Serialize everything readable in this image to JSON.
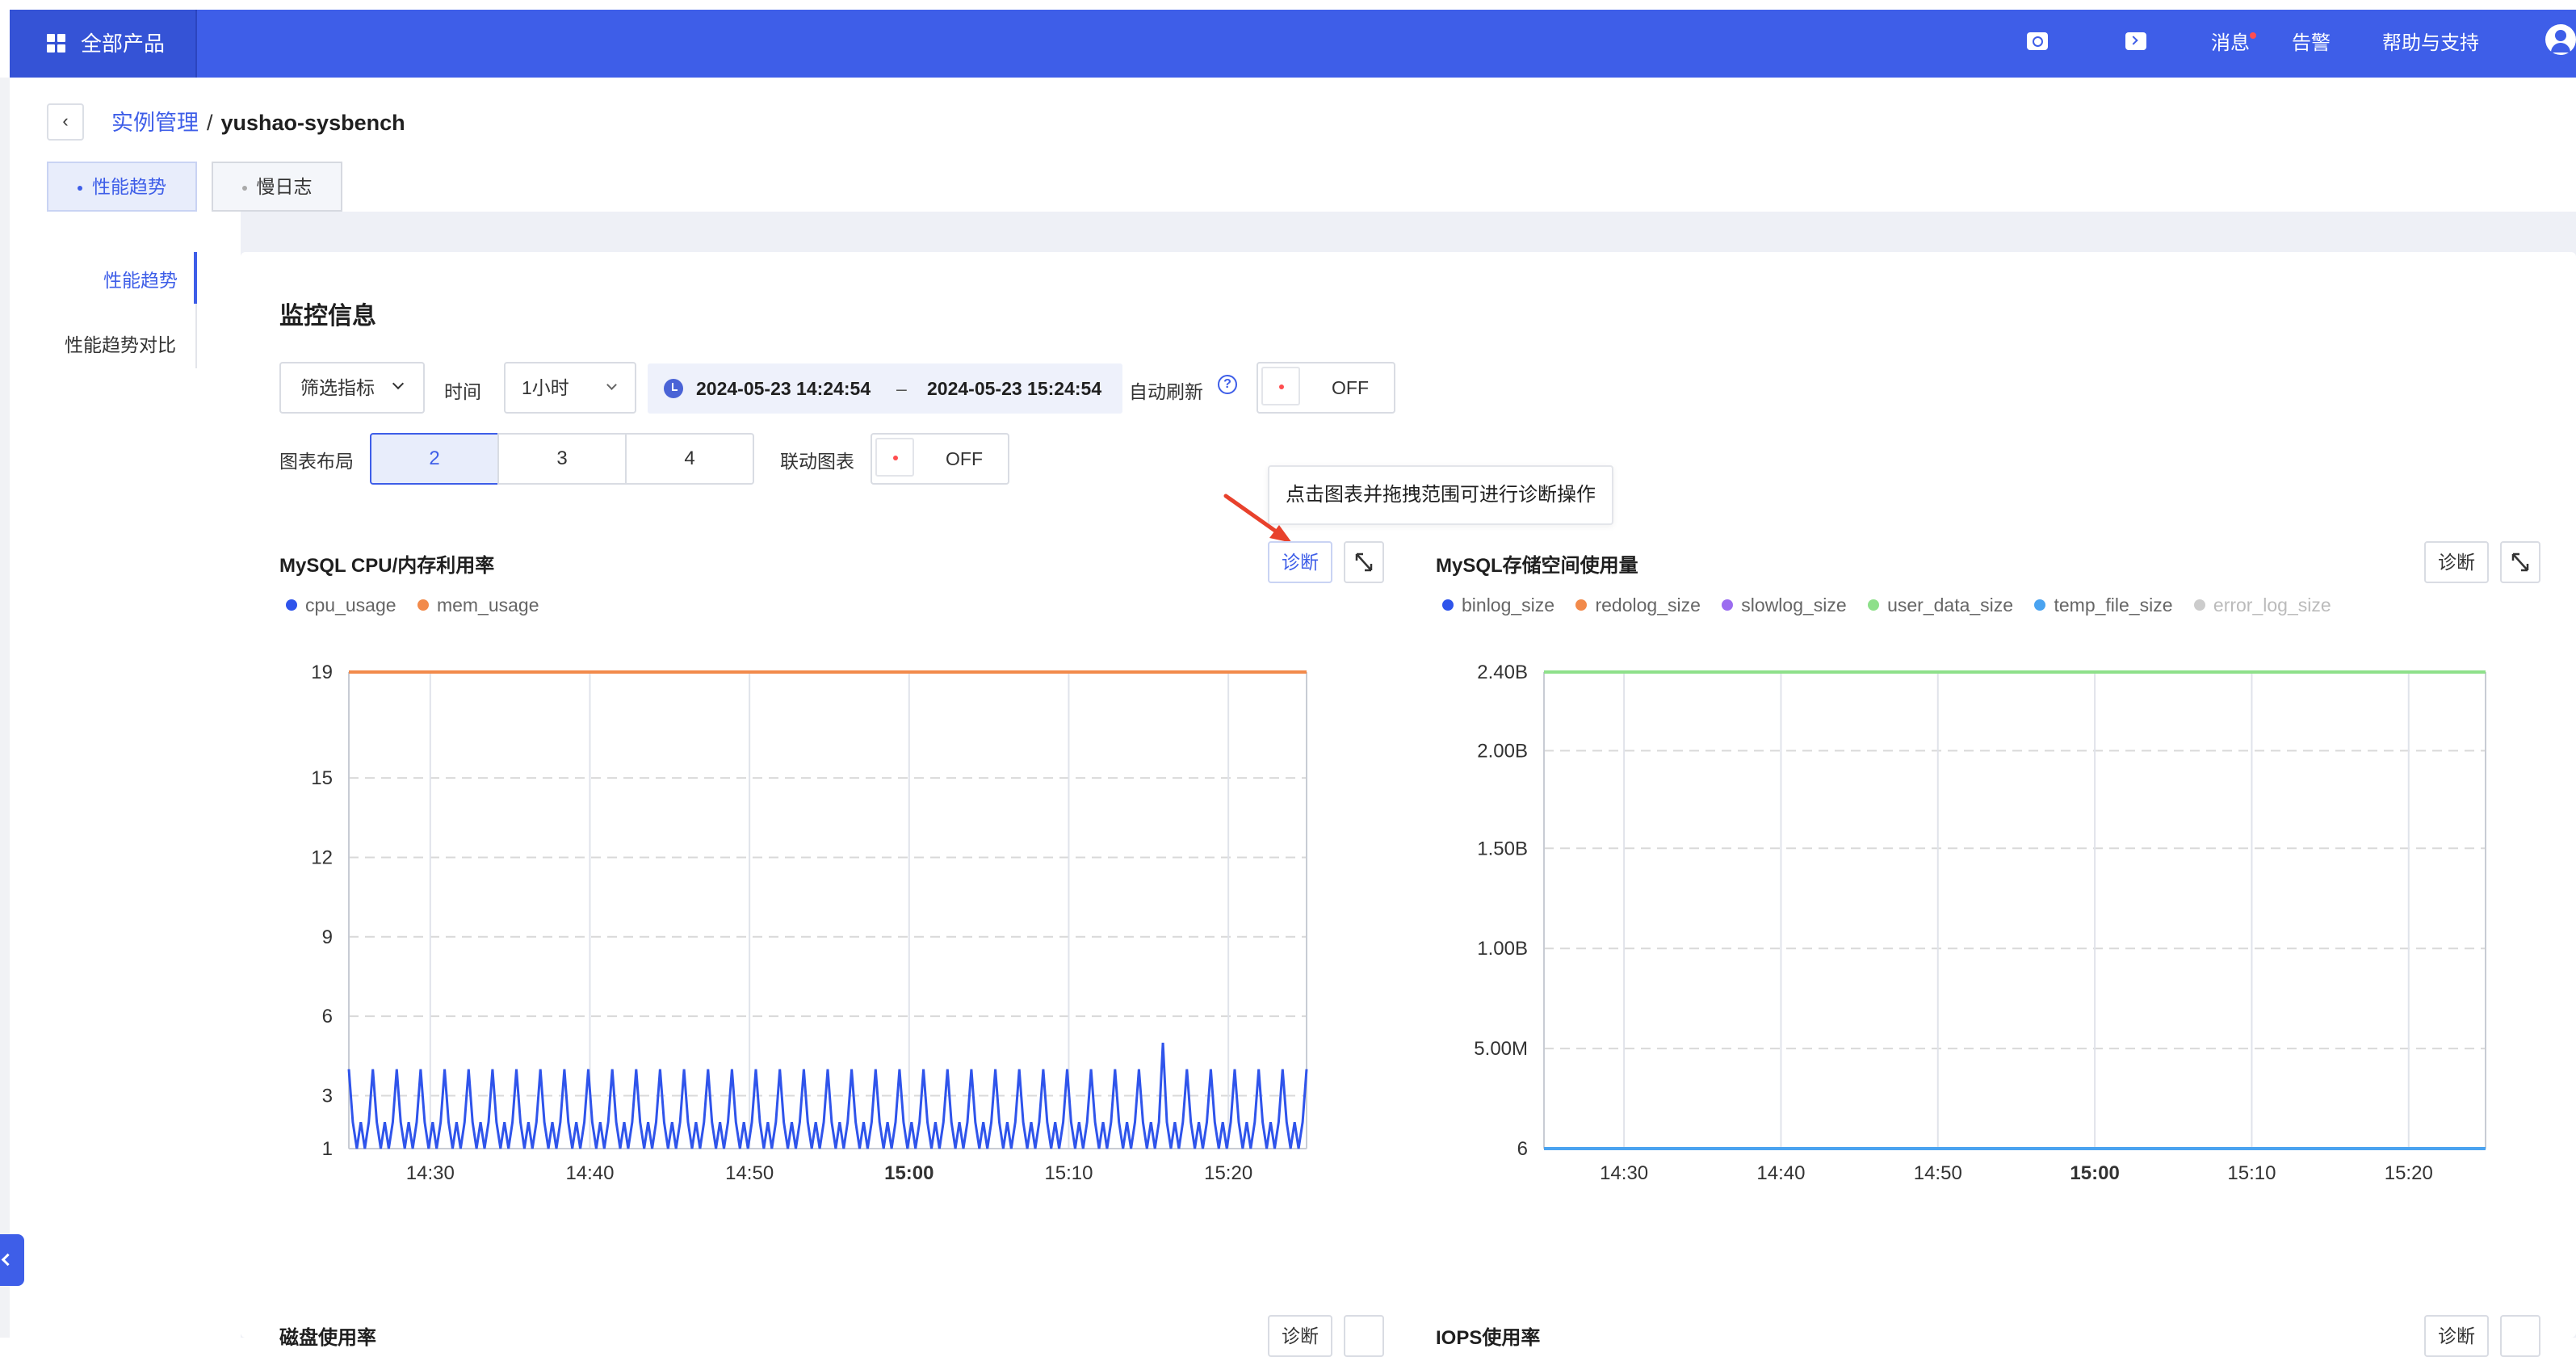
{
  "topbar": {
    "products_label": "全部产品",
    "messages_label": "消息",
    "alerts_label": "告警",
    "help_label": "帮助与支持"
  },
  "breadcrumb": {
    "parent": "实例管理",
    "separator": "/",
    "current": "yushao-sysbench"
  },
  "tabs": [
    {
      "label": "性能趋势",
      "active": true
    },
    {
      "label": "慢日志",
      "active": false
    }
  ],
  "sidenav": [
    {
      "label": "性能趋势",
      "active": true
    },
    {
      "label": "性能趋势对比",
      "active": false
    }
  ],
  "monitor": {
    "title": "监控信息",
    "filter_label": "筛选指标",
    "time_label": "时间",
    "time_value": "1小时",
    "start": "2024-05-23 14:24:54",
    "range_sep": "–",
    "end": "2024-05-23 15:24:54",
    "auto_refresh_label": "自动刷新",
    "auto_refresh_state": "OFF",
    "layout_label": "图表布局",
    "layout_options": [
      "2",
      "3",
      "4"
    ],
    "layout_selected": "2",
    "link_charts_label": "联动图表",
    "link_charts_state": "OFF",
    "tooltip": "点击图表并拖拽范围可进行诊断操作"
  },
  "colors": {
    "accent": "#3e5ee8",
    "arrow": "#e8412c"
  },
  "charts_meta": [
    {
      "title": "MySQL CPU/内存利用率",
      "diagnose_label": "诊断"
    },
    {
      "title": "MySQL存储空间使用量",
      "diagnose_label": "诊断"
    }
  ],
  "lower_row": [
    {
      "title": "磁盘使用率",
      "diagnose_label": "诊断"
    },
    {
      "title": "IOPS使用率",
      "diagnose_label": "诊断"
    }
  ],
  "chart_data": [
    {
      "type": "line",
      "title": "MySQL CPU/内存利用率",
      "x_ticks": [
        "14:30",
        "14:40",
        "14:50",
        "15:00",
        "15:10",
        "15:20"
      ],
      "x_range": [
        "14:24:54",
        "15:24:54"
      ],
      "y_ticks": [
        "1",
        "3",
        "6",
        "9",
        "12",
        "15",
        "19"
      ],
      "ylim": [
        1,
        19
      ],
      "grid": true,
      "legend_position": "top-left",
      "series": [
        {
          "name": "cpu_usage",
          "color": "#2f54eb",
          "baseline": 2,
          "peak": 4,
          "spike_time": "15:16",
          "spike_value": 5,
          "pattern": "oscillating every ~30s between 1 and 4"
        },
        {
          "name": "mem_usage",
          "color": "#f28a4b",
          "values": [
            19,
            19
          ]
        }
      ]
    },
    {
      "type": "line",
      "title": "MySQL存储空间使用量",
      "x_ticks": [
        "14:30",
        "14:40",
        "14:50",
        "15:00",
        "15:10",
        "15:20"
      ],
      "x_range": [
        "14:24:54",
        "15:24:54"
      ],
      "y_ticks": [
        "6",
        "5.00M",
        "1.00B",
        "1.50B",
        "2.00B",
        "2.40B"
      ],
      "grid": true,
      "legend_position": "top-left",
      "series": [
        {
          "name": "binlog_size",
          "color": "#2f54eb",
          "values": [
            6,
            6
          ]
        },
        {
          "name": "redolog_size",
          "color": "#f28a4b",
          "values": [
            6,
            6
          ]
        },
        {
          "name": "slowlog_size",
          "color": "#9b6cf0",
          "values": [
            6,
            6
          ]
        },
        {
          "name": "user_data_size",
          "color": "#8ee08a",
          "values": [
            "2.40B",
            "2.40B"
          ]
        },
        {
          "name": "temp_file_size",
          "color": "#4aa3f0",
          "values": [
            6,
            6
          ]
        },
        {
          "name": "error_log_size",
          "color": "#cccccc",
          "disabled": true,
          "values": [
            6,
            6
          ]
        }
      ]
    }
  ]
}
